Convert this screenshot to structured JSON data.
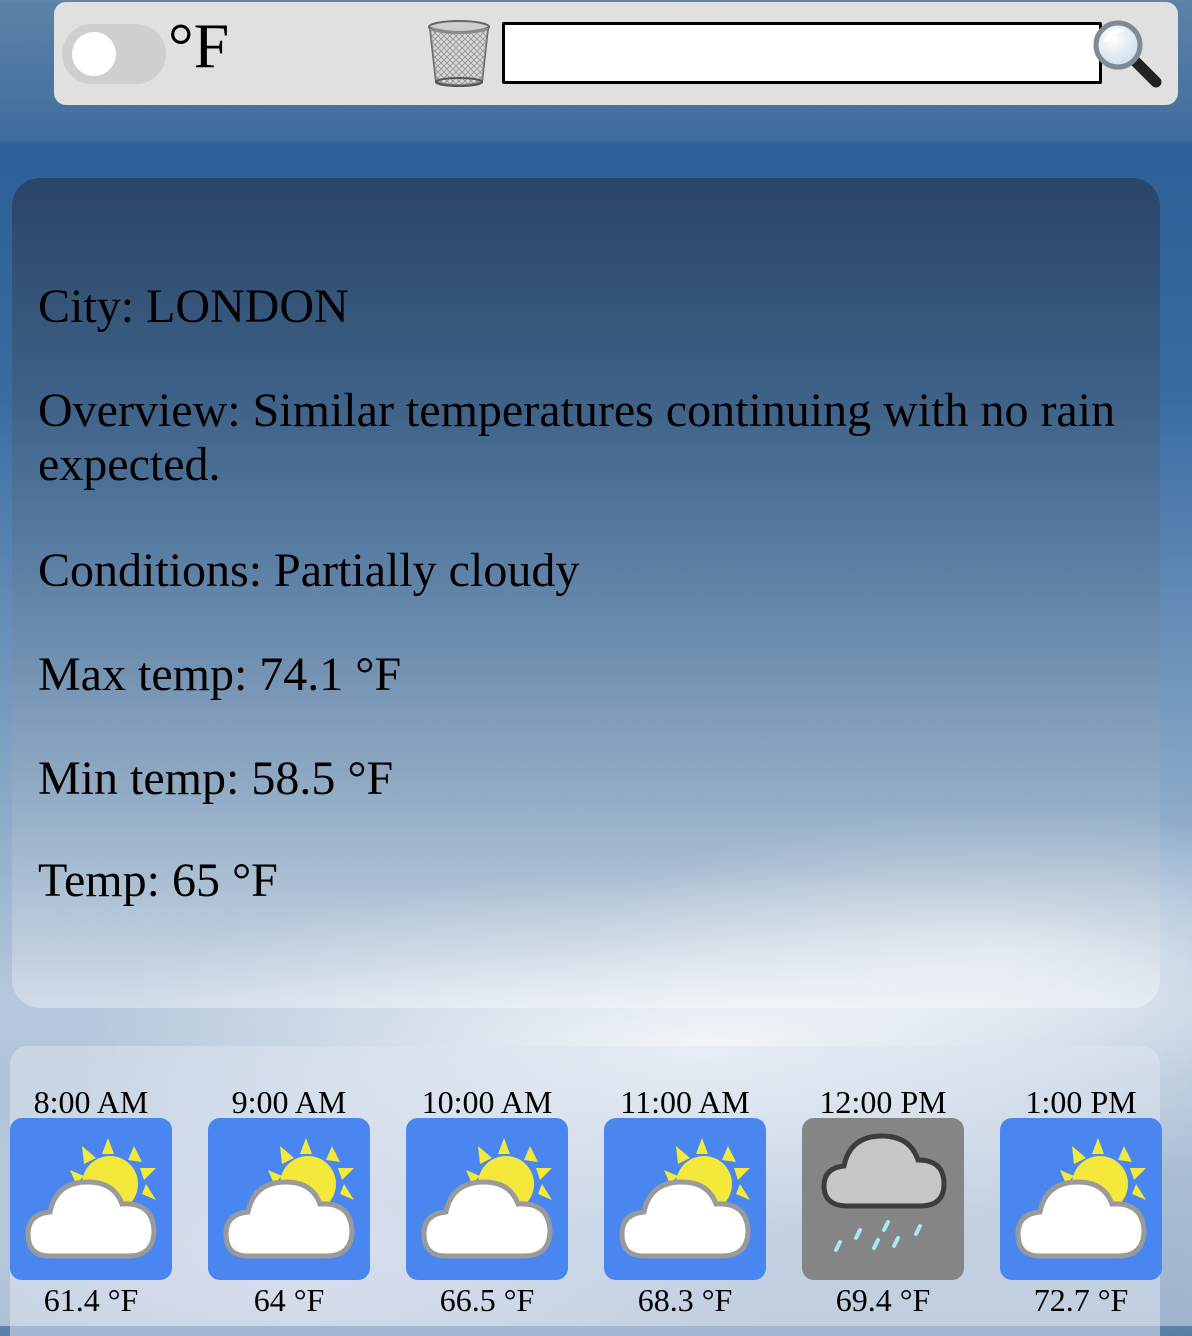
{
  "toolbar": {
    "unit_label": "°F",
    "unit_toggle": "fahrenheit",
    "search_value": "",
    "icons": [
      "trash-icon",
      "search-icon"
    ]
  },
  "summary": {
    "city": "City: LONDON",
    "overview": "Overview: Similar temperatures continuing with no rain expected.",
    "conditions": "Conditions: Partially cloudy",
    "max_temp": "Max temp: 74.1 °F",
    "min_temp": "Min temp: 58.5 °F",
    "temp": "Temp: 65 °F"
  },
  "hourly": [
    {
      "time": "8:00 AM",
      "temp": "61.4 °F",
      "icon": "partly-cloudy-icon",
      "bg": "#4a86f0"
    },
    {
      "time": "9:00 AM",
      "temp": "64 °F",
      "icon": "partly-cloudy-icon",
      "bg": "#4a86f0"
    },
    {
      "time": "10:00 AM",
      "temp": "66.5 °F",
      "icon": "partly-cloudy-icon",
      "bg": "#4a86f0"
    },
    {
      "time": "11:00 AM",
      "temp": "68.3 °F",
      "icon": "partly-cloudy-icon",
      "bg": "#4a86f0"
    },
    {
      "time": "12:00 PM",
      "temp": "69.4 °F",
      "icon": "rain-icon",
      "bg": "#858585"
    },
    {
      "time": "1:00 PM",
      "temp": "72.7 °F",
      "icon": "partly-cloudy-icon",
      "bg": "#4a86f0"
    }
  ]
}
